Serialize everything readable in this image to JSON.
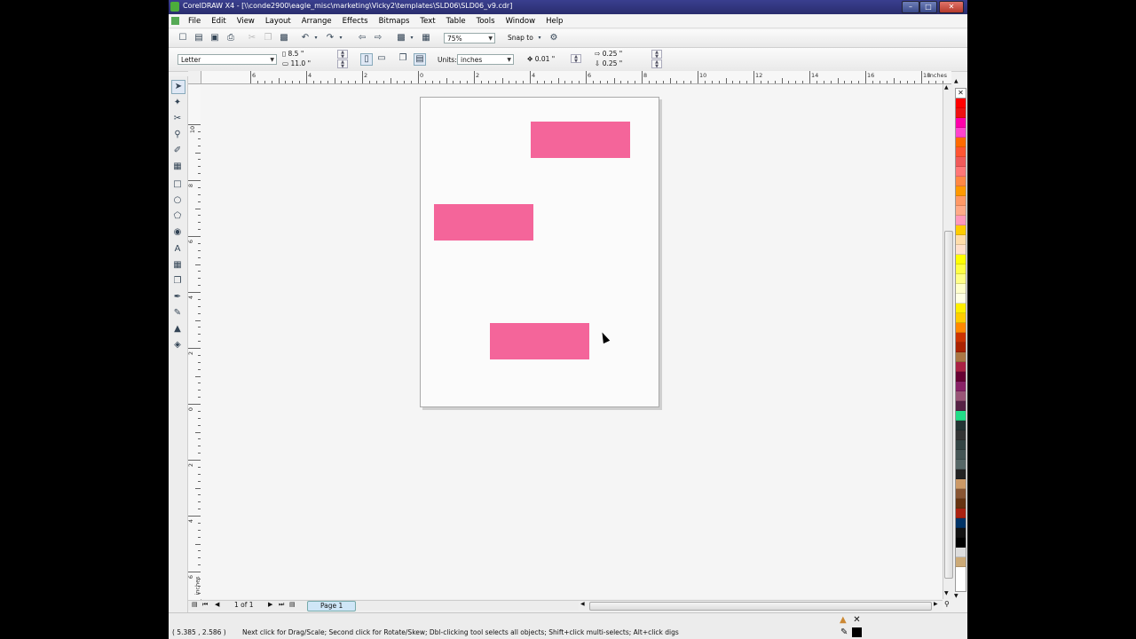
{
  "window": {
    "title": "CorelDRAW X4 - [\\\\conde2900\\eagle_misc\\marketing\\Vicky2\\templates\\SLD06\\SLD06_v9.cdr]",
    "minimize": "–",
    "maximize": "□",
    "close": "✕"
  },
  "menu": [
    "File",
    "Edit",
    "View",
    "Layout",
    "Arrange",
    "Effects",
    "Bitmaps",
    "Text",
    "Table",
    "Tools",
    "Window",
    "Help"
  ],
  "toolbar": {
    "zoom_level": "75%",
    "snap_to": "Snap to"
  },
  "property_bar": {
    "paper_size": "Letter",
    "width": "8.5 \"",
    "height": "11.0 \"",
    "units_label": "Units:",
    "units_value": "inches",
    "nudge": "0.01 \"",
    "dup_x": "0.25 \"",
    "dup_y": "0.25 \""
  },
  "ruler": {
    "top_labels": [
      "6",
      "4",
      "2",
      "0",
      "2",
      "4",
      "6",
      "8",
      "10",
      "12",
      "14",
      "16",
      "18"
    ],
    "top_unit": "inches",
    "left_labels": [
      "10",
      "8",
      "6",
      "4",
      "2",
      "0",
      "2",
      "4",
      "6"
    ],
    "left_unit": "inches"
  },
  "page_nav": {
    "count": "1 of 1",
    "tab": "Page 1"
  },
  "status": {
    "coords": "( 5.385 , 2.586 )",
    "hint": "Next click for Drag/Scale; Second click for Rotate/Skew; Dbl-clicking tool selects all objects; Shift+click multi-selects; Alt+click digs"
  },
  "shapes": {
    "fill": "#f4659a"
  },
  "palette": [
    "#ff0000",
    "#ee1111",
    "#ff00aa",
    "#ff44cc",
    "#ff6a00",
    "#ff5533",
    "#f05a5a",
    "#ff7777",
    "#ff8844",
    "#ff9900",
    "#ff9966",
    "#ffaa88",
    "#ff99bb",
    "#ffcc00",
    "#ffddaa",
    "#ffe0cc",
    "#ffff00",
    "#ffff44",
    "#ffff88",
    "#ffffcc",
    "#ffffe6",
    "#fff000",
    "#ffcc00",
    "#ff8800",
    "#cc3300",
    "#aa2200",
    "#aa7744",
    "#aa2244",
    "#660033",
    "#882266",
    "#995577",
    "#552244",
    "#22dd88",
    "#223333",
    "#333333",
    "#334444",
    "#445555",
    "#556666",
    "#222222",
    "#cc9966",
    "#885533",
    "#663311",
    "#aa2211",
    "#003366",
    "#111111",
    "#000000",
    "#dddddd",
    "#ccaa77"
  ]
}
